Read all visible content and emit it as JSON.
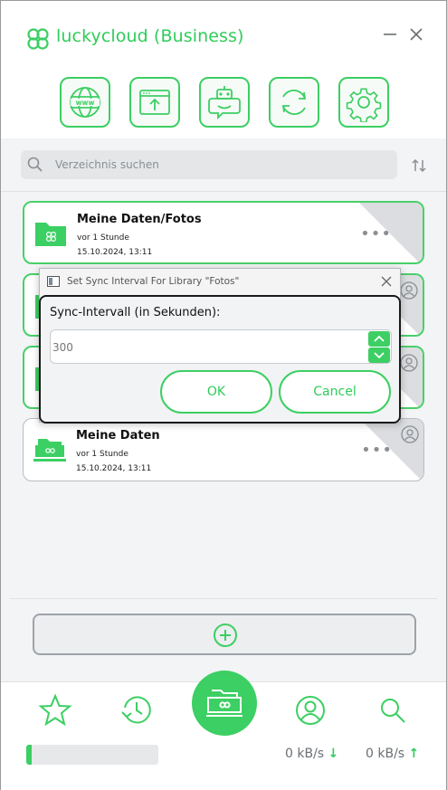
{
  "app": {
    "title": "luckycloud (Business)"
  },
  "window_controls": {
    "minimize_icon": "minimize-icon",
    "close_icon": "close-icon"
  },
  "toolbar": [
    {
      "name": "web-button",
      "icon": "globe-www-icon"
    },
    {
      "name": "upload-button",
      "icon": "browser-upload-icon"
    },
    {
      "name": "assistant-button",
      "icon": "robot-chat-icon"
    },
    {
      "name": "sync-button",
      "icon": "sync-arrows-icon"
    },
    {
      "name": "settings-button",
      "icon": "gear-icon"
    }
  ],
  "search": {
    "placeholder": "Verzeichnis suchen",
    "value": ""
  },
  "libraries": [
    {
      "name": "Meine Daten/Fotos",
      "modified": "vor 1 Stunde",
      "date": "15.10.2024, 13:11",
      "icon": "folder-icon",
      "menu": "•••"
    },
    {
      "name": "",
      "modified": "",
      "date": "",
      "icon": "folder-icon",
      "menu": ""
    },
    {
      "name": "",
      "modified": "",
      "date": "",
      "icon": "folder-icon",
      "menu": ""
    },
    {
      "name": "Meine Daten",
      "modified": "vor 1 Stunde",
      "date": "15.10.2024, 13:11",
      "icon": "library-icon",
      "menu": "•••"
    }
  ],
  "dialog": {
    "title": "Set Sync Interval For Library \"Fotos\"",
    "label": "Sync-Intervall (in Sekunden):",
    "input_placeholder": "300",
    "ok_label": "OK",
    "cancel_label": "Cancel"
  },
  "bottom_nav": [
    "star-icon",
    "history-icon",
    "library-icon",
    "user-icon",
    "search-icon"
  ],
  "status": {
    "download_rate": "0 kB/s",
    "upload_rate": "0 kB/s",
    "progress_fraction": 0.04
  },
  "colors": {
    "accent": "#3ccf63",
    "accent_text": "#2fcc5a",
    "panel": "#f3f4f6"
  }
}
